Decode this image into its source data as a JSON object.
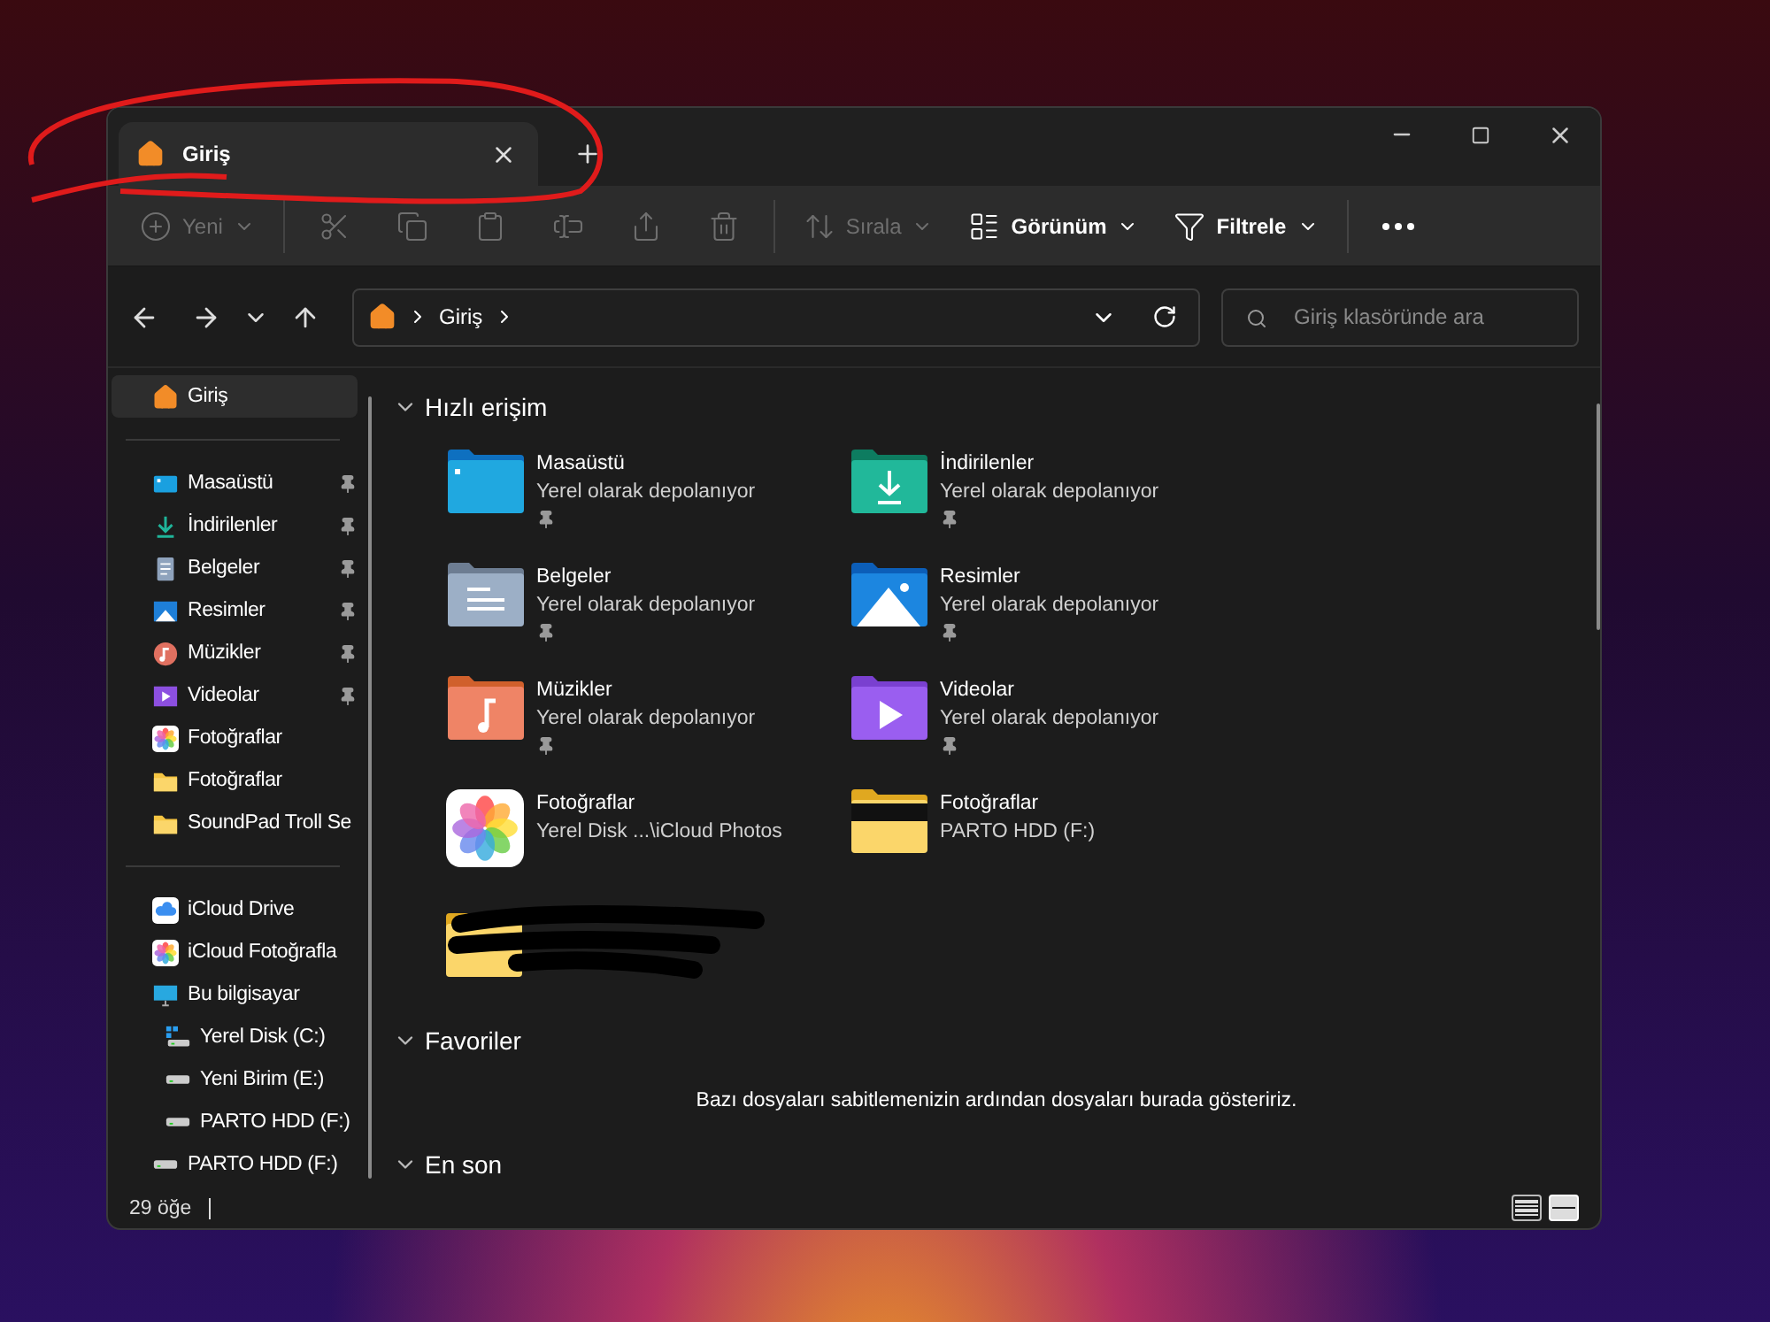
{
  "tabs": [
    {
      "label": "Giriş",
      "selected": true
    }
  ],
  "toolbar": [
    {
      "kind": "new",
      "label": "Yeni",
      "disabled": true,
      "dropdown": true
    },
    {
      "kind": "cut",
      "disabled": true
    },
    {
      "kind": "copy",
      "disabled": true
    },
    {
      "kind": "paste",
      "disabled": true
    },
    {
      "kind": "rename",
      "disabled": true
    },
    {
      "kind": "share",
      "disabled": true
    },
    {
      "kind": "delete",
      "disabled": true
    },
    {
      "kind": "sort",
      "label": "Sırala",
      "disabled": true,
      "dropdown": true
    },
    {
      "kind": "view",
      "label": "Görünüm",
      "disabled": false,
      "dropdown": true
    },
    {
      "kind": "filter",
      "label": "Filtrele",
      "disabled": false,
      "dropdown": true
    },
    {
      "kind": "more",
      "disabled": false
    }
  ],
  "address": {
    "crumbs": [
      "Giriş"
    ]
  },
  "search": {
    "placeholder": "Giriş klasöründe ara"
  },
  "sidebar": {
    "groups": [
      [
        {
          "kind": "home",
          "label": "Giriş",
          "selected": true,
          "pinned": false
        }
      ],
      [
        {
          "kind": "desktop",
          "label": "Masaüstü",
          "selected": false,
          "pinned": true
        },
        {
          "kind": "downloads",
          "label": "İndirilenler",
          "selected": false,
          "pinned": true
        },
        {
          "kind": "documents",
          "label": "Belgeler",
          "selected": false,
          "pinned": true
        },
        {
          "kind": "pictures",
          "label": "Resimler",
          "selected": false,
          "pinned": true
        },
        {
          "kind": "music",
          "label": "Müzikler",
          "selected": false,
          "pinned": true
        },
        {
          "kind": "videos",
          "label": "Videolar",
          "selected": false,
          "pinned": true
        },
        {
          "kind": "photos",
          "label": "Fotoğraflar",
          "selected": false,
          "pinned": false
        },
        {
          "kind": "folder",
          "label": "Fotoğraflar",
          "selected": false,
          "pinned": false
        },
        {
          "kind": "folder",
          "label": "SoundPad Troll Se",
          "selected": false,
          "pinned": false
        }
      ],
      [
        {
          "kind": "cloud",
          "label": "iCloud Drive",
          "selected": false,
          "pinned": false
        },
        {
          "kind": "photos",
          "label": "iCloud Fotoğrafla",
          "selected": false,
          "pinned": false
        },
        {
          "kind": "pc",
          "label": "Bu bilgisayar",
          "selected": false,
          "pinned": false,
          "children": [
            {
              "kind": "windrive",
              "label": "Yerel Disk (C:)",
              "selected": false,
              "pinned": false
            },
            {
              "kind": "drive",
              "label": "Yeni Birim (E:)",
              "selected": false,
              "pinned": false
            },
            {
              "kind": "drive",
              "label": "PARTO HDD (F:)",
              "selected": false,
              "pinned": false
            }
          ]
        },
        {
          "kind": "drive",
          "label": "PARTO HDD (F:)",
          "selected": false,
          "pinned": false
        }
      ]
    ]
  },
  "sections": [
    {
      "title": "Hızlı erişim",
      "expanded": true,
      "items": [
        {
          "kind": "desktop",
          "name": "Masaüstü",
          "location": "Yerel olarak depolanıyor",
          "pinned": true
        },
        {
          "kind": "downloads",
          "name": "İndirilenler",
          "location": "Yerel olarak depolanıyor",
          "pinned": true
        },
        {
          "kind": "documents",
          "name": "Belgeler",
          "location": "Yerel olarak depolanıyor",
          "pinned": true
        },
        {
          "kind": "pictures",
          "name": "Resimler",
          "location": "Yerel olarak depolanıyor",
          "pinned": true
        },
        {
          "kind": "music",
          "name": "Müzikler",
          "location": "Yerel olarak depolanıyor",
          "pinned": true
        },
        {
          "kind": "videos",
          "name": "Videolar",
          "location": "Yerel olarak depolanıyor",
          "pinned": true
        },
        {
          "kind": "photos",
          "name": "Fotoğraflar",
          "location": "Yerel Disk ...\\iCloud Photos",
          "pinned": false
        },
        {
          "kind": "folder",
          "name": "Fotoğraflar",
          "location": "PARTO HDD (F:)",
          "pinned": false
        },
        {
          "kind": "redacted",
          "pinned": false
        }
      ]
    },
    {
      "title": "Favoriler",
      "expanded": true,
      "message": "Bazı dosyaları sabitlemenizin ardından dosyaları burada gösteririz."
    },
    {
      "title": "En son",
      "expanded": true
    }
  ],
  "status_bar": {
    "count": "29 öğe"
  },
  "view_modes": [
    {
      "kind": "details",
      "selected": false
    },
    {
      "kind": "tiles",
      "selected": true
    }
  ]
}
